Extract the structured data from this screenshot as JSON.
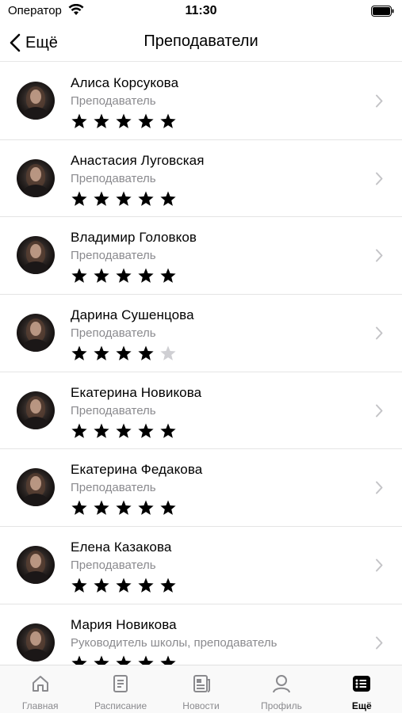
{
  "status_bar": {
    "carrier": "Оператор",
    "time": "11:30"
  },
  "nav": {
    "back_label": "Ещё",
    "title": "Преподаватели"
  },
  "colors": {
    "star_filled": "#000000",
    "star_empty": "#cfcfd3",
    "chevron": "#c4c4c7",
    "inactive_tab": "#8a8a8e"
  },
  "teachers": [
    {
      "name": "Алиса Корсукова",
      "role": "Преподаватель",
      "rating": 5
    },
    {
      "name": "Анастасия Луговская",
      "role": "Преподаватель",
      "rating": 5
    },
    {
      "name": "Владимир Головков",
      "role": "Преподаватель",
      "rating": 5
    },
    {
      "name": "Дарина Сушенцова",
      "role": "Преподаватель",
      "rating": 4
    },
    {
      "name": "Екатерина Новикова",
      "role": "Преподаватель",
      "rating": 5
    },
    {
      "name": "Екатерина Федакова",
      "role": "Преподаватель",
      "rating": 5
    },
    {
      "name": "Елена Казакова",
      "role": "Преподаватель",
      "rating": 5
    },
    {
      "name": "Мария Новикова",
      "role": "Руководитель школы, преподаватель",
      "rating": 5
    }
  ],
  "tabs": [
    {
      "label": "Главная",
      "icon": "home-icon",
      "active": false
    },
    {
      "label": "Расписание",
      "icon": "schedule-icon",
      "active": false
    },
    {
      "label": "Новости",
      "icon": "news-icon",
      "active": false
    },
    {
      "label": "Профиль",
      "icon": "profile-icon",
      "active": false
    },
    {
      "label": "Ещё",
      "icon": "more-icon",
      "active": true
    }
  ]
}
